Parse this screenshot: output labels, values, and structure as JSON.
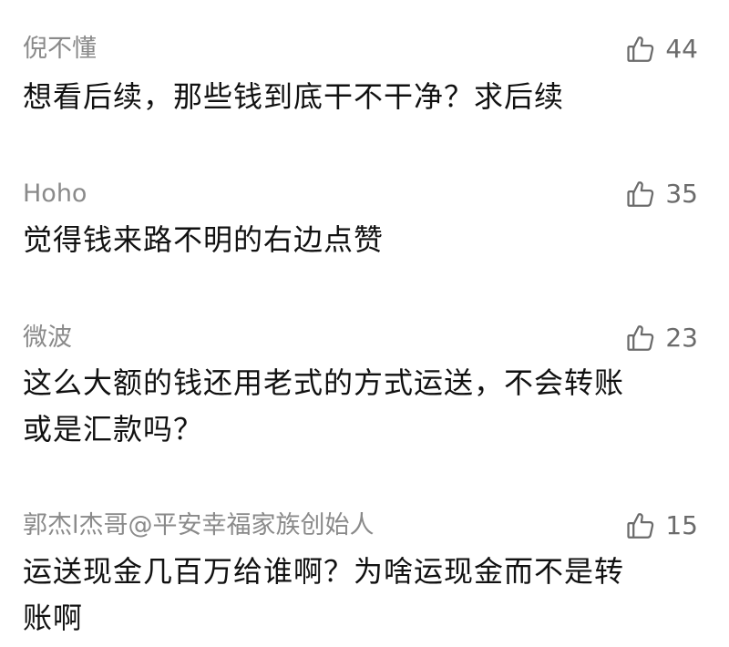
{
  "comments": [
    {
      "user": "倪不懂",
      "likes": "44",
      "lines": [
        "想看后续，那些钱到底干不干净？求后续"
      ]
    },
    {
      "user": "Hoho",
      "likes": "35",
      "lines": [
        "觉得钱来路不明的右边点赞"
      ]
    },
    {
      "user": "微波",
      "likes": "23",
      "lines": [
        "这么大额的钱还用老式的方式运送，不会转账",
        "或是汇款吗？"
      ]
    },
    {
      "user": "郭杰l杰哥@平安幸福家族创始人",
      "likes": "15",
      "lines": [
        "运送现金几百万给谁啊？为啥运现金而不是转",
        "账啊"
      ]
    }
  ],
  "icons": {
    "like": "thumbs-up-icon"
  },
  "colors": {
    "username": "#8a8a8a",
    "content": "#111111",
    "like": "#6b6b6b",
    "background": "#ffffff"
  }
}
